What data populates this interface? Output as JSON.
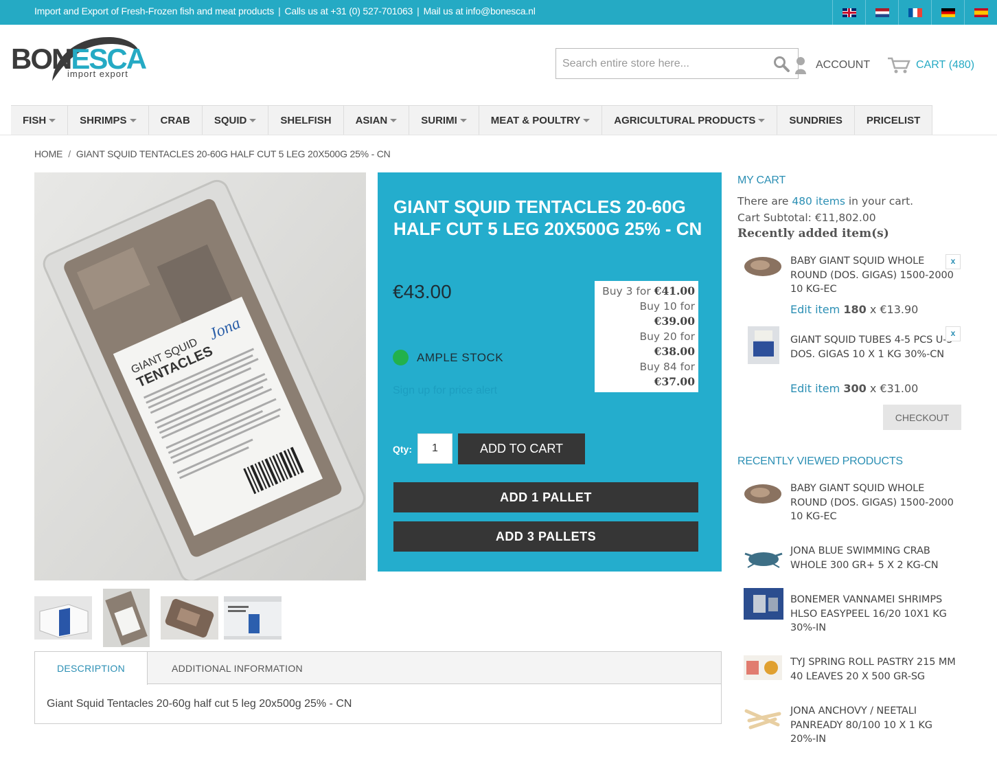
{
  "topbar": {
    "tagline": "Import and Export of Fresh-Frozen fish and meat products",
    "phone": "Calls us at +31 (0) 527-701063",
    "mail": "Mail us at info@bonesca.nl",
    "separator": "|"
  },
  "logo": {
    "brand_left": "BON",
    "brand_right": "ESCA",
    "subtitle": "import export"
  },
  "search": {
    "placeholder": "Search entire store here..."
  },
  "header": {
    "account_label": "ACCOUNT",
    "cart_label": "CART",
    "cart_count": "(480)"
  },
  "nav": [
    {
      "label": "FISH",
      "dropdown": true
    },
    {
      "label": "SHRIMPS",
      "dropdown": true
    },
    {
      "label": "CRAB",
      "dropdown": false
    },
    {
      "label": "SQUID",
      "dropdown": true
    },
    {
      "label": "SHELFISH",
      "dropdown": false
    },
    {
      "label": "ASIAN",
      "dropdown": true
    },
    {
      "label": "SURIMI",
      "dropdown": true
    },
    {
      "label": "MEAT & POULTRY",
      "dropdown": true
    },
    {
      "label": "AGRICULTURAL PRODUCTS",
      "dropdown": true
    },
    {
      "label": "SUNDRIES",
      "dropdown": false
    },
    {
      "label": "PRICELIST",
      "dropdown": false
    }
  ],
  "breadcrumb": {
    "home": "HOME",
    "separator": "/",
    "current": "GIANT SQUID TENTACLES 20-60G HALF CUT 5 LEG 20X500G 25% - CN"
  },
  "product": {
    "title": "GIANT SQUID TENTACLES 20-60G HALF CUT 5 LEG 20X500G 25% - CN",
    "price": "€43.00",
    "tiers": [
      {
        "prefix": "Buy 3 for",
        "price": "€41.00"
      },
      {
        "prefix": "Buy 10 for",
        "price": "€39.00"
      },
      {
        "prefix": "Buy 20 for",
        "price": "€38.00"
      },
      {
        "prefix": "Buy 84 for",
        "price": "€37.00"
      }
    ],
    "stock": "AMPLE STOCK",
    "price_alert": "Sign up for price alert",
    "qty_label": "Qty:",
    "qty_value": "1",
    "add_to_cart": "ADD TO CART",
    "add_1_pallet": "ADD  1  PALLET",
    "add_3_pallets": "ADD  3  PALLETS",
    "label_text_brand": "Jona",
    "label_text_product": "GIANT SQUID TENTACLES"
  },
  "tabs": {
    "description": "DESCRIPTION",
    "additional": "ADDITIONAL INFORMATION",
    "content": "Giant Squid Tentacles 20-60g half cut 5 leg 20x500g 25% - CN"
  },
  "sidebar": {
    "my_cart": "MY CART",
    "there_are": "There are",
    "items_link": "480 items",
    "in_cart": "in your cart.",
    "subtotal_label": "Cart Subtotal:",
    "subtotal": "€11,802.00",
    "recently_added": "Recently added item(s)",
    "cart_items": [
      {
        "name": "BABY GIANT SQUID WHOLE ROUND (DOS. GIGAS) 1500-2000 10 KG-EC",
        "edit": "Edit item",
        "qty": "180",
        "times": "x",
        "price": "€13.90",
        "remove": "x"
      },
      {
        "name": "GIANT SQUID TUBES 4-5 PCS U-5 DOS. GIGAS 10 X 1 KG 30%-CN",
        "edit": "Edit item",
        "qty": "300",
        "times": "x",
        "price": "€31.00",
        "remove": "x"
      }
    ],
    "checkout": "CHECKOUT",
    "recently_viewed": "RECENTLY VIEWED PRODUCTS",
    "viewed": [
      {
        "name": "BABY GIANT SQUID WHOLE ROUND (DOS. GIGAS) 1500-2000 10 KG-EC"
      },
      {
        "name": "JONA BLUE SWIMMING CRAB WHOLE 300 GR+ 5 X 2 KG-CN"
      },
      {
        "name": "BONEMER VANNAMEI SHRIMPS HLSO EASYPEEL 16/20 10X1 KG 30%-IN"
      },
      {
        "name": "TYJ SPRING ROLL PASTRY 215 MM 40 LEAVES 20 X 500 GR-SG"
      },
      {
        "name": "JONA ANCHOVY / NEETALI PANREADY 80/100 10 X 1 KG 20%-IN"
      }
    ]
  },
  "colors": {
    "accent": "#25aac4",
    "panel": "#24adcd",
    "dark_button": "#363636",
    "stock_green": "#22b14c",
    "link": "#2b8fb4"
  }
}
